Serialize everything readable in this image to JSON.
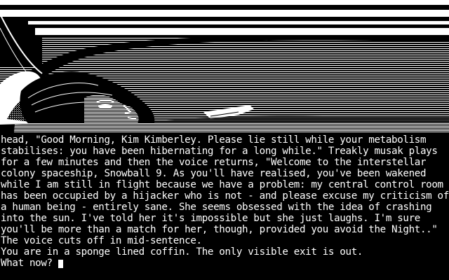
{
  "palette": {
    "background": "#000000",
    "foreground": "#ffffff"
  },
  "scene": {
    "description_icon": "hibernation-coffin-scene"
  },
  "story": {
    "lines": [
      "head, \"Good Morning, Kim Kimberley. Please lie still while your metabolism",
      "stabilises: you have been hibernating for a long while.\" Treakly musak plays",
      "for a few minutes and then the voice returns, \"Welcome to the interstellar",
      "colony spaceship, Snowball 9. As you'll have realised, you've been wakened",
      "while I am still in flight because we have a problem: my central control room",
      "has been occupied by a hijacker who is not - and please excuse my criticism of",
      "a human being - entirely sane. She seems obsessed with the idea of crashing",
      "into the sun. I've told her it's impossible but she just laughs. I'm sure",
      "you'll be more than a match for her, though, provided you avoid the Night..\"",
      "The voice cuts off in mid-sentence.",
      "You are in a sponge lined coffin. The only visible exit is out."
    ]
  },
  "prompt": {
    "text": "What now?",
    "input_value": ""
  }
}
